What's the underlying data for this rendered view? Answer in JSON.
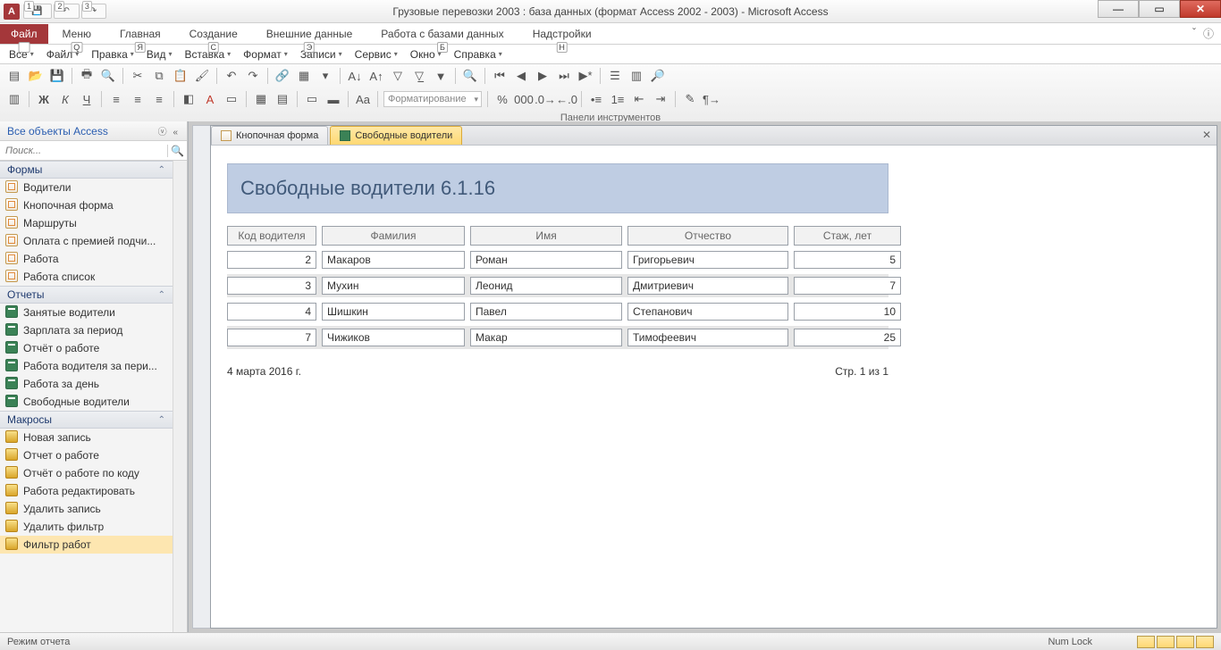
{
  "window": {
    "title": "Грузовые перевозки 2003 : база данных (формат Access 2002 - 2003)  -  Microsoft Access",
    "app_letter": "А"
  },
  "ribbon": {
    "file": "Файл",
    "tabs": [
      "Меню",
      "Главная",
      "Создание",
      "Внешние данные",
      "Работа с базами данных",
      "Надстройки"
    ],
    "tab_keys": [
      "Q",
      "Я",
      "С",
      "Э",
      "Б",
      "Н"
    ],
    "help_icon": "ⓘ"
  },
  "menubar": {
    "items": [
      "Все",
      "Файл",
      "Правка",
      "Вид",
      "Вставка",
      "Формат",
      "Записи",
      "Сервис",
      "Окно",
      "Справка"
    ],
    "keys": [
      "",
      "Ф",
      "П",
      "",
      "В",
      "Ф",
      "З",
      "",
      "О",
      ""
    ]
  },
  "toolbars": {
    "formatting_placeholder": "Форматирование",
    "panels_label": "Панели инструментов"
  },
  "nav": {
    "title": "Все объекты Access",
    "search_placeholder": "Поиск...",
    "groups": {
      "forms": {
        "title": "Формы",
        "items": [
          "Водители",
          "Кнопочная форма",
          "Маршруты",
          "Оплата с премией подчи...",
          "Работа",
          "Работа список"
        ]
      },
      "reports": {
        "title": "Отчеты",
        "items": [
          "Занятые водители",
          "Зарплата за период",
          "Отчёт о работе",
          "Работа водителя за пери...",
          "Работа за день",
          "Свободные водители"
        ]
      },
      "macros": {
        "title": "Макросы",
        "items": [
          "Новая запись",
          "Отчет о работе",
          "Отчёт о работе по коду",
          "Работа редактировать",
          "Удалить запись",
          "Удалить фильтр",
          "Фильтр работ"
        ]
      }
    }
  },
  "tabs": {
    "inactive": "Кнопочная форма",
    "active": "Свободные водители"
  },
  "report": {
    "title": "Свободные водители  6.1.16",
    "headers": [
      "Код водителя",
      "Фамилия",
      "Имя",
      "Отчество",
      "Стаж, лет"
    ],
    "rows": [
      {
        "id": "2",
        "last": "Макаров",
        "first": "Роман",
        "mid": "Григорьевич",
        "exp": "5"
      },
      {
        "id": "3",
        "last": "Мухин",
        "first": "Леонид",
        "mid": "Дмитриевич",
        "exp": "7"
      },
      {
        "id": "4",
        "last": "Шишкин",
        "first": "Павел",
        "mid": "Степанович",
        "exp": "10"
      },
      {
        "id": "7",
        "last": "Чижиков",
        "first": "Макар",
        "mid": "Тимофеевич",
        "exp": "25"
      }
    ],
    "footer_date": "4 марта 2016 г.",
    "footer_page": "Стр. 1 из 1"
  },
  "status": {
    "mode": "Режим отчета",
    "numlock": "Num Lock"
  }
}
